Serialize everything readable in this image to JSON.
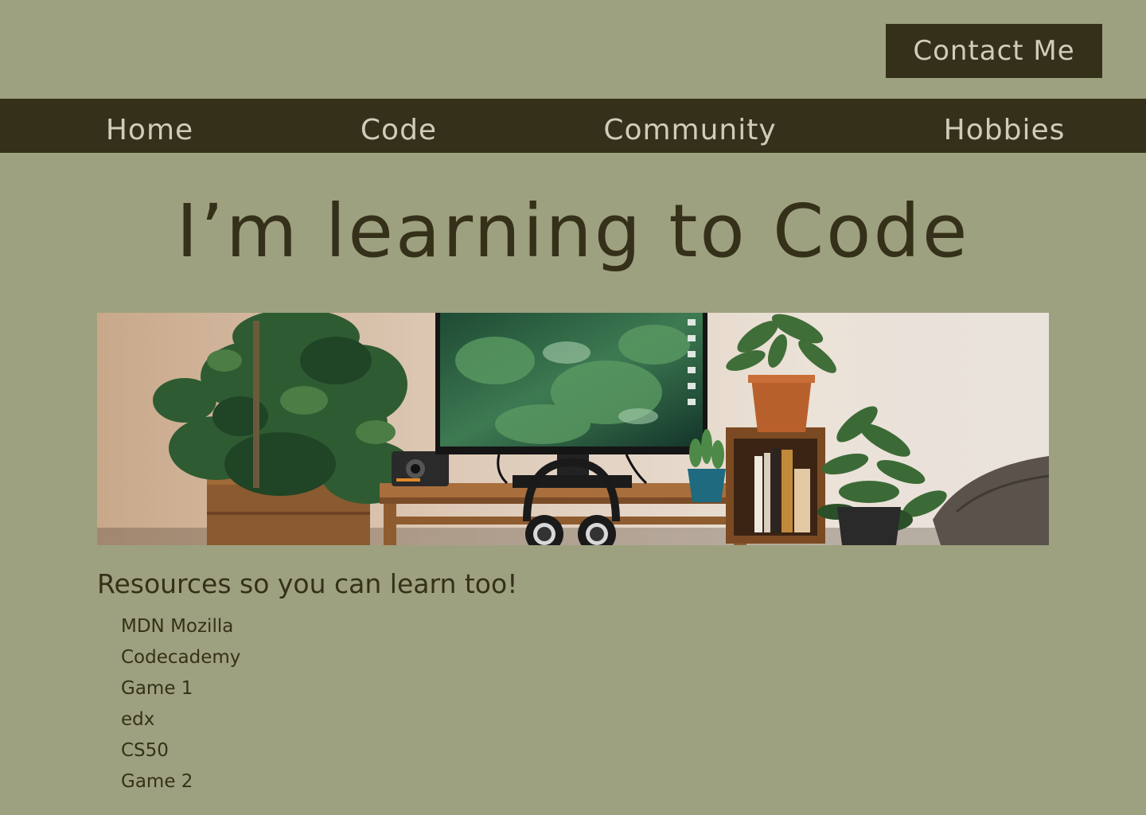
{
  "header": {
    "contact_label": "Contact Me"
  },
  "nav": {
    "items": [
      {
        "label": "Home"
      },
      {
        "label": "Code"
      },
      {
        "label": "Community"
      },
      {
        "label": "Hobbies"
      }
    ]
  },
  "hero": {
    "title": "I’m learning to Code"
  },
  "banner": {
    "image_subject": "desk-with-monitor-and-houseplants"
  },
  "resources": {
    "heading": "Resources so you can learn too!",
    "items": [
      {
        "label": "MDN Mozilla"
      },
      {
        "label": "Codecademy"
      },
      {
        "label": "Game 1"
      },
      {
        "label": "edx"
      },
      {
        "label": "CS50"
      },
      {
        "label": "Game 2"
      }
    ]
  },
  "colors": {
    "background": "#9ea17f",
    "dark": "#35301a",
    "light_text": "#cfcdb9"
  }
}
